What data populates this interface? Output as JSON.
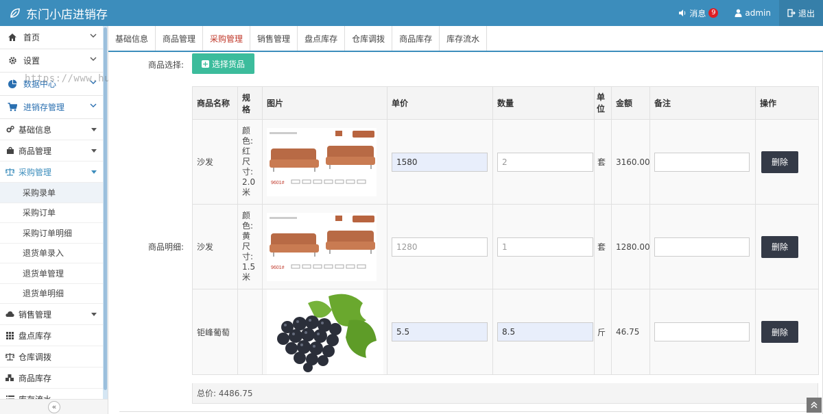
{
  "app": {
    "title": "东门小店进销存"
  },
  "topbar": {
    "messages_label": "消息",
    "messages_count": "9",
    "user_label": "admin",
    "logout_label": "退出"
  },
  "sidebar": {
    "main_items": [
      {
        "label": "首页",
        "icon": "home-icon"
      },
      {
        "label": "设置",
        "icon": "gear-icon"
      },
      {
        "label": "数据中心",
        "icon": "pie-chart-icon"
      },
      {
        "label": "进销存管理",
        "icon": "cart-icon"
      }
    ],
    "sub_items": [
      {
        "label": "基础信息",
        "icon": "cogs-icon"
      },
      {
        "label": "商品管理",
        "icon": "bag-icon"
      },
      {
        "label": "采购管理",
        "icon": "scale-icon"
      }
    ],
    "purchase_children": [
      "采购录单",
      "采购订单",
      "采购订单明细",
      "退货单录入",
      "退货单管理",
      "退货单明细"
    ],
    "more_items": [
      {
        "label": "销售管理",
        "icon": "cloud-icon"
      },
      {
        "label": "盘点库存",
        "icon": "grid-icon"
      },
      {
        "label": "仓库调拨",
        "icon": "scale-icon"
      },
      {
        "label": "商品库存",
        "icon": "cubes-icon"
      },
      {
        "label": "库存流水",
        "icon": "list-icon"
      }
    ],
    "collapse_label": "«"
  },
  "watermark": "https://www.huzhan.com/ishop47093",
  "tabs": [
    "基础信息",
    "商品管理",
    "采购管理",
    "销售管理",
    "盘点库存",
    "仓库调拨",
    "商品库存",
    "库存流水"
  ],
  "form": {
    "select_label": "商品选择:",
    "select_button": "选择货品",
    "detail_label": "商品明细:"
  },
  "table": {
    "headers": [
      "商品名称",
      "规格",
      "图片",
      "单价",
      "数量",
      "单位",
      "金额",
      "备注",
      "操作"
    ],
    "rows": [
      {
        "name": "沙发",
        "spec": "颜色:红尺寸:2.0米",
        "price": "1580",
        "qty": "2",
        "unit": "套",
        "amount": "3160.00",
        "note": "",
        "action": "删除",
        "image": "sofa-image",
        "image_label": "9601#"
      },
      {
        "name": "沙发",
        "spec": "颜色:黄尺寸:1.5米",
        "price": "1280",
        "qty": "1",
        "unit": "套",
        "amount": "1280.00",
        "note": "",
        "action": "删除",
        "image": "sofa-image",
        "image_label": "9601#"
      },
      {
        "name": "钜峰葡萄",
        "spec": "",
        "price": "5.5",
        "qty": "8.5",
        "unit": "斤",
        "amount": "46.75",
        "note": "",
        "action": "删除",
        "image": "grape-image"
      }
    ],
    "total": "总价: 4486.75"
  },
  "colors": {
    "topbar": "#3c8dbc",
    "accent_button": "#3cbc9c",
    "delete_button": "#343a47",
    "active_tab": "#c0392b"
  }
}
